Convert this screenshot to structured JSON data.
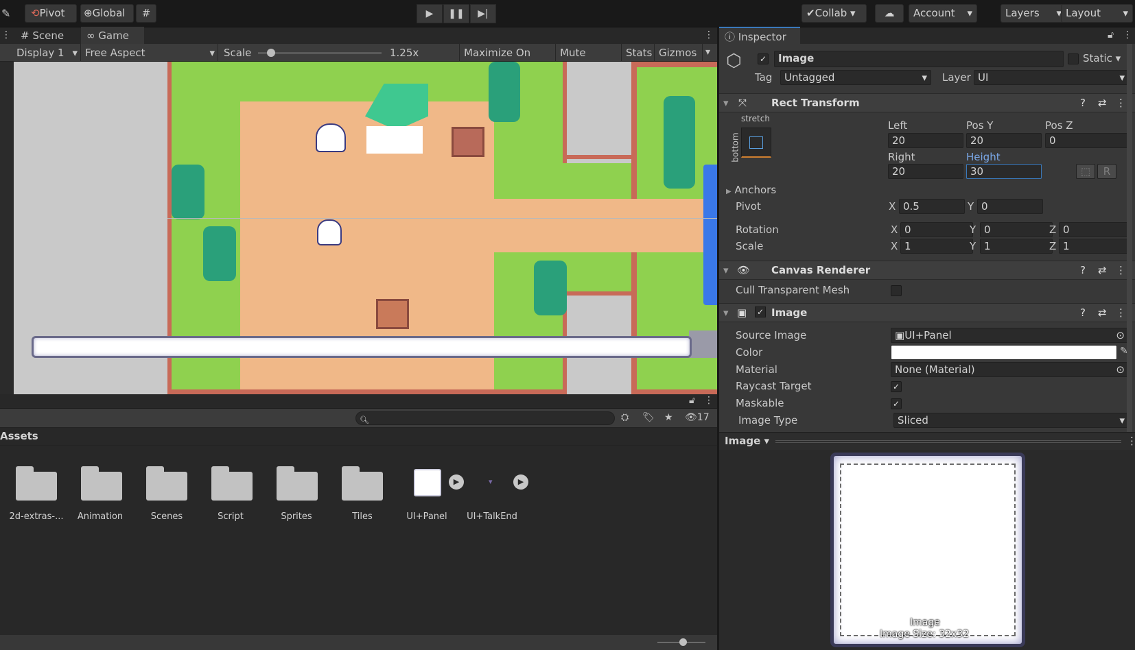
{
  "toolbar": {
    "pivot_label": "Pivot",
    "global_label": "Global",
    "collab_label": "Collab",
    "account_label": "Account",
    "layers_label": "Layers",
    "layout_label": "Layout"
  },
  "view_tabs": {
    "scene": "Scene",
    "game": "Game"
  },
  "game_toolbar": {
    "display": "Display 1",
    "aspect": "Free Aspect",
    "scale_label": "Scale",
    "scale_value": "1.25x",
    "scale_level": 0.08,
    "maximize": "Maximize On Play",
    "mute": "Mute Audio",
    "stats": "Stats",
    "gizmos": "Gizmos"
  },
  "project": {
    "search_placeholder": "",
    "hidden_count": "17",
    "breadcrumb": "Assets",
    "items": [
      {
        "label": "2d-extras-...",
        "type": "folder"
      },
      {
        "label": "Animation",
        "type": "folder"
      },
      {
        "label": "Scenes",
        "type": "folder"
      },
      {
        "label": "Script",
        "type": "folder"
      },
      {
        "label": "Sprites",
        "type": "folder"
      },
      {
        "label": "Tiles",
        "type": "folder"
      },
      {
        "label": "UI+Panel",
        "type": "sprite"
      },
      {
        "label": "UI+TalkEnd",
        "type": "sprite"
      }
    ]
  },
  "inspector": {
    "tab": "Inspector",
    "object_name": "Image",
    "static_label": "Static",
    "tag_label": "Tag",
    "tag_value": "Untagged",
    "layer_label": "Layer",
    "layer_value": "UI",
    "rect_transform": {
      "title": "Rect Transform",
      "anchor_h": "stretch",
      "anchor_v": "bottom",
      "left_label": "Left",
      "left": "20",
      "posy_label": "Pos Y",
      "posy": "20",
      "posz_label": "Pos Z",
      "posz": "0",
      "right_label": "Right",
      "right": "20",
      "height_label": "Height",
      "height": "30",
      "r_button": "R",
      "anchors_label": "Anchors",
      "pivot_label": "Pivot",
      "pivot_x": "0.5",
      "pivot_y": "0",
      "rotation_label": "Rotation",
      "rot_x": "0",
      "rot_y": "0",
      "rot_z": "0",
      "scale_label": "Scale",
      "scale_x": "1",
      "scale_y": "1",
      "scale_z": "1",
      "x": "X",
      "y": "Y",
      "z": "Z"
    },
    "canvas_renderer": {
      "title": "Canvas Renderer",
      "cull_label": "Cull Transparent Mesh"
    },
    "image": {
      "title": "Image",
      "source_label": "Source Image",
      "source_value": "UI+Panel",
      "color_label": "Color",
      "color_value": "#ffffff",
      "material_label": "Material",
      "material_value": "None (Material)",
      "raycast_label": "Raycast Target",
      "maskable_label": "Maskable",
      "type_label": "Image Type",
      "type_value": "Sliced"
    },
    "preview": {
      "header": "Image",
      "caption_name": "Image",
      "caption_size": "Image Size: 32x32"
    }
  },
  "colors": {
    "grass": "#8fd14f",
    "dirt": "#f0b888",
    "border": "#c86a58",
    "tree": "#2aa07a",
    "water": "#3a78e8"
  }
}
